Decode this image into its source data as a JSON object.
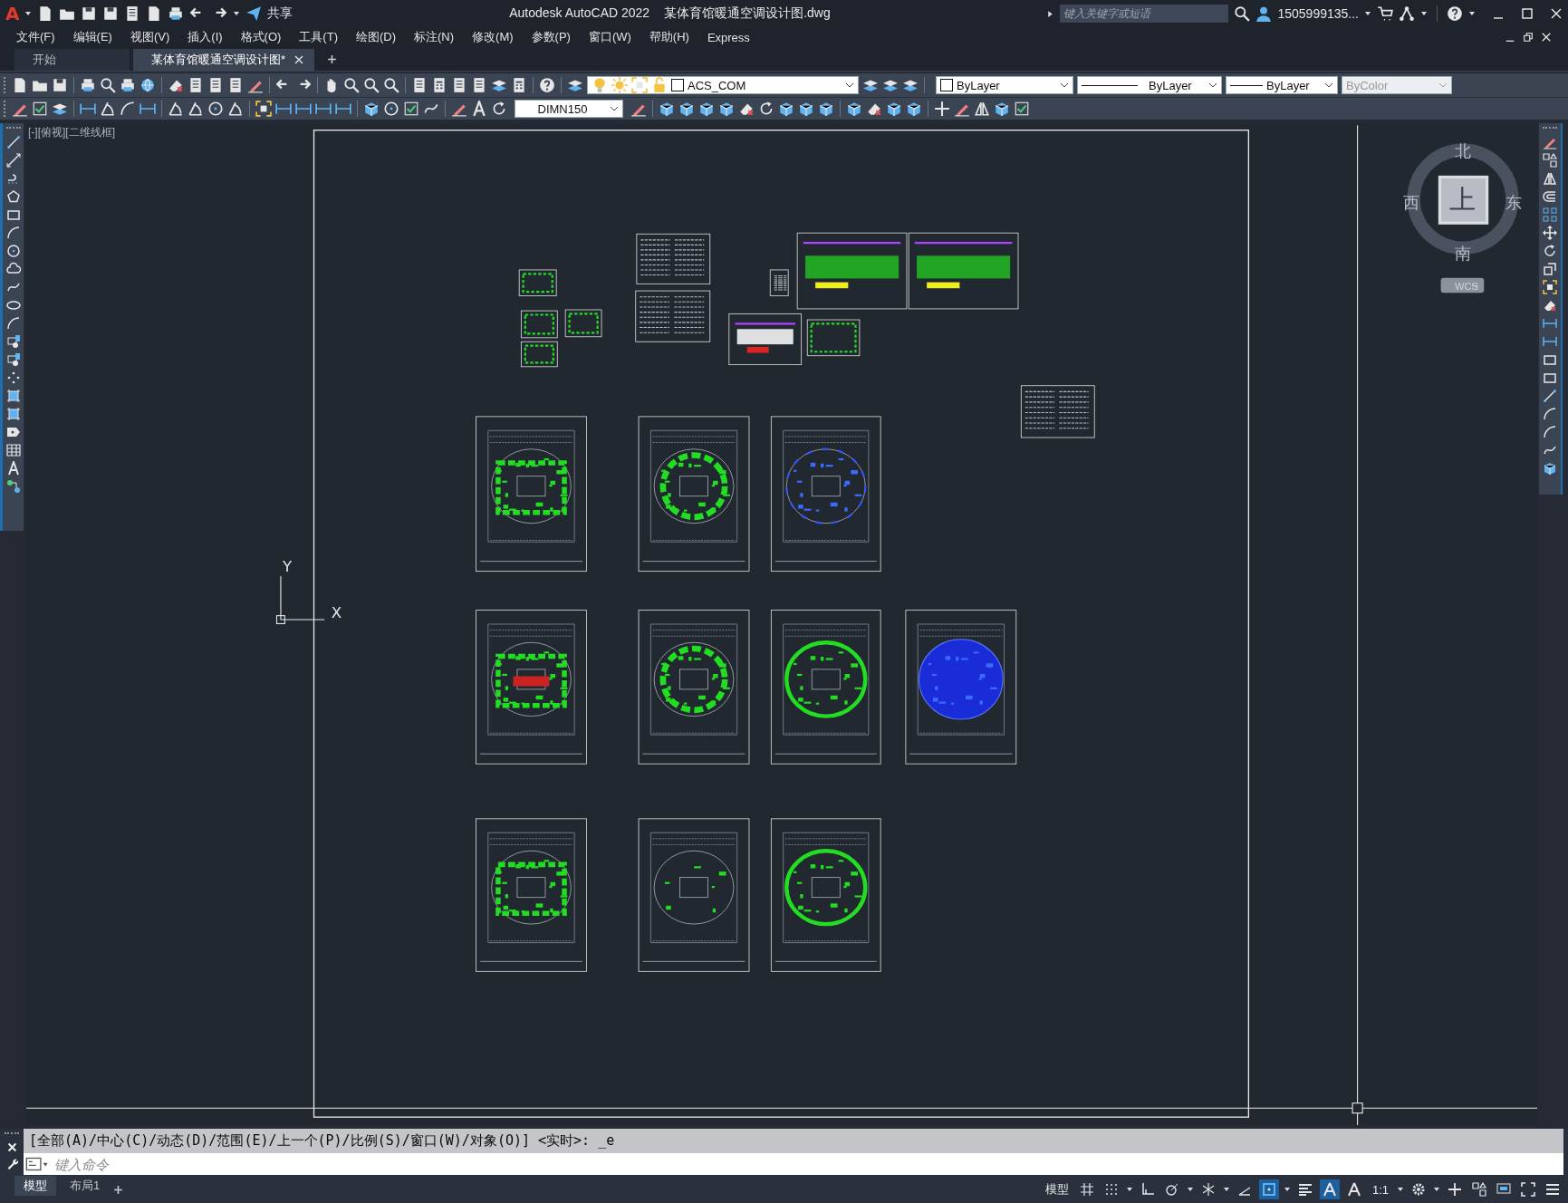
{
  "title_bar": {
    "app_logo": "A",
    "share": "共享",
    "app_title": "Autodesk AutoCAD 2022",
    "file_name": "某体育馆暖通空调设计图.dwg",
    "search_placeholder": "键入关键字或短语",
    "user": "1505999135..."
  },
  "menu": [
    "文件(F)",
    "编辑(E)",
    "视图(V)",
    "插入(I)",
    "格式(O)",
    "工具(T)",
    "绘图(D)",
    "标注(N)",
    "修改(M)",
    "参数(P)",
    "窗口(W)",
    "帮助(H)",
    "Express"
  ],
  "doc_tabs": [
    {
      "label": "开始",
      "selected": false
    },
    {
      "label": "某体育馆暖通空调设计图*",
      "selected": true
    }
  ],
  "toolbar": {
    "layer": "ACS_COM",
    "color_setting": "ByLayer",
    "linetype": "ByLayer",
    "lineweight": "ByLayer",
    "plot_style": {
      "value": "ByColor",
      "disabled": true
    },
    "dim_style": "DIMN150"
  },
  "viewport": {
    "label": "[-][俯视][二维线框]"
  },
  "view_cube": {
    "north": "北",
    "south": "南",
    "east": "东",
    "west": "西",
    "face": "上",
    "ucs": "WCS"
  },
  "ucs_icon": {
    "x": "X",
    "y": "Y"
  },
  "command": {
    "history": "[全部(A)/中心(C)/动态(D)/范围(E)/上一个(P)/比例(S)/窗口(W)/对象(O)] <实时>: _e",
    "placeholder": "键入命令"
  },
  "layout_tabs": [
    {
      "label": "模型",
      "selected": true
    },
    {
      "label": "布局1",
      "selected": false
    }
  ],
  "status_bar": {
    "space": "模型",
    "scale": "1:1",
    "toggles": [
      {
        "on": false
      },
      {
        "on": false
      },
      {
        "on": false
      },
      {
        "on": false
      },
      {
        "on": false
      },
      {
        "on": false
      },
      {
        "on": true
      },
      {
        "on": false
      },
      {
        "on": true
      },
      {
        "on": false
      }
    ]
  }
}
